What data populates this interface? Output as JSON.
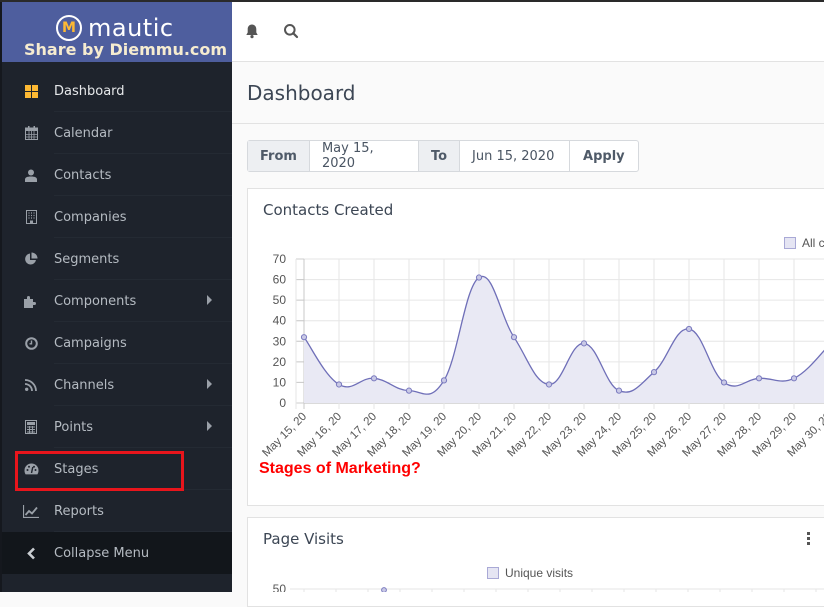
{
  "brand": {
    "logo_mark": "M",
    "name": "mautic",
    "watermark": "Share by Diemmu.com",
    "color": "#4e5e9e",
    "logo_accent": "#fdb933"
  },
  "sidebar": {
    "items": [
      {
        "label": "Dashboard",
        "icon": "dashboard-grid-icon",
        "active": true,
        "submenu": false
      },
      {
        "label": "Calendar",
        "icon": "calendar-icon",
        "active": false,
        "submenu": false
      },
      {
        "label": "Contacts",
        "icon": "user-icon",
        "active": false,
        "submenu": false
      },
      {
        "label": "Companies",
        "icon": "building-icon",
        "active": false,
        "submenu": false
      },
      {
        "label": "Segments",
        "icon": "pie-chart-icon",
        "active": false,
        "submenu": false
      },
      {
        "label": "Components",
        "icon": "puzzle-icon",
        "active": false,
        "submenu": true
      },
      {
        "label": "Campaigns",
        "icon": "clock-icon",
        "active": false,
        "submenu": false
      },
      {
        "label": "Channels",
        "icon": "rss-icon",
        "active": false,
        "submenu": true
      },
      {
        "label": "Points",
        "icon": "calculator-icon",
        "active": false,
        "submenu": true
      },
      {
        "label": "Stages",
        "icon": "tachometer-icon",
        "active": false,
        "submenu": false
      },
      {
        "label": "Reports",
        "icon": "line-chart-icon",
        "active": false,
        "submenu": false
      }
    ],
    "collapse_label": "Collapse Menu"
  },
  "topbar": {
    "icons": [
      "bell-icon",
      "search-icon"
    ]
  },
  "page": {
    "title": "Dashboard"
  },
  "datefilter": {
    "from_label": "From",
    "from_value": "May 15, 2020",
    "to_label": "To",
    "to_value": "Jun 15, 2020",
    "apply_label": "Apply"
  },
  "annotation": {
    "text": "Stages of Marketing?",
    "color": "#ff0000"
  },
  "widgets": {
    "contacts_created": {
      "title": "Contacts Created",
      "legend": "All c"
    },
    "page_visits": {
      "title": "Page Visits",
      "legend": "Unique visits",
      "y_top_tick": "50"
    }
  },
  "chart_data": [
    {
      "type": "area",
      "title": "Contacts Created",
      "xlabel": "",
      "ylabel": "",
      "ylim": [
        0,
        70
      ],
      "yticks": [
        0,
        10,
        20,
        30,
        40,
        50,
        60,
        70
      ],
      "grid": true,
      "legend": "top-right",
      "categories": [
        "May 15, 20",
        "May 16, 20",
        "May 17, 20",
        "May 18, 20",
        "May 19, 20",
        "May 20, 20",
        "May 21, 20",
        "May 22, 20",
        "May 23, 20",
        "May 24, 20",
        "May 25, 20",
        "May 26, 20",
        "May 27, 20",
        "May 28, 20",
        "May 29, 20",
        "May 30, 20"
      ],
      "series": [
        {
          "name": "All contacts",
          "color": "#6f6fb8",
          "fill": "#e9e9f4",
          "values": [
            32,
            9,
            12,
            6,
            11,
            61,
            32,
            9,
            29,
            6,
            15,
            36,
            10,
            12,
            12,
            28
          ]
        }
      ]
    },
    {
      "type": "line",
      "title": "Page Visits",
      "legend": "top-center",
      "yticks_visible": [
        50
      ],
      "series": [
        {
          "name": "Unique visits",
          "color": "#6f6fb8",
          "values": []
        }
      ]
    }
  ]
}
